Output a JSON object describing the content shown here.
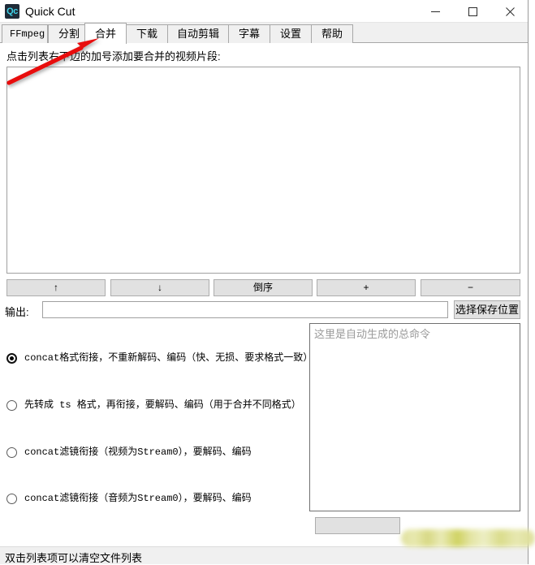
{
  "window": {
    "app_icon_text": "Qc",
    "title": "Quick Cut",
    "controls": {
      "minimize": "minimize-icon",
      "maximize": "maximize-icon",
      "close": "close-icon"
    }
  },
  "tabs": [
    {
      "label": "FFmpeg",
      "active": false,
      "mono": true
    },
    {
      "label": "分割",
      "active": false,
      "mono": false
    },
    {
      "label": "合并",
      "active": true,
      "mono": false
    },
    {
      "label": "下载",
      "active": false,
      "mono": false
    },
    {
      "label": "自动剪辑",
      "active": false,
      "mono": false
    },
    {
      "label": "字幕",
      "active": false,
      "mono": false
    },
    {
      "label": "设置",
      "active": false,
      "mono": false
    },
    {
      "label": "帮助",
      "active": false,
      "mono": false
    }
  ],
  "main": {
    "hint_label": "点击列表右下边的加号添加要合并的视频片段:",
    "file_list_items": [],
    "list_buttons": [
      {
        "label": "↑",
        "name": "move-up-button"
      },
      {
        "label": "↓",
        "name": "move-down-button"
      },
      {
        "label": "倒序",
        "name": "reverse-order-button"
      },
      {
        "label": "+",
        "name": "add-file-button"
      },
      {
        "label": "−",
        "name": "remove-file-button"
      }
    ],
    "output": {
      "label": "输出:",
      "value": "",
      "placeholder": "",
      "browse_button": "选择保存位置"
    },
    "merge_modes": [
      {
        "label": "concat格式衔接，不重新解码、编码（快、无损、要求格式一致）",
        "checked": true
      },
      {
        "label": "先转成 ts 格式，再衔接，要解码、编码（用于合并不同格式）",
        "checked": false
      },
      {
        "label": "concat滤镜衔接（视频为Stream0），要解码、编码",
        "checked": false
      },
      {
        "label": "concat滤镜衔接（音频为Stream0），要解码、编码",
        "checked": false
      }
    ],
    "command_box": {
      "value": "",
      "placeholder": "这里是自动生成的总命令"
    },
    "run_button": ""
  },
  "statusbar": {
    "text": "双击列表项可以清空文件列表"
  },
  "annotation": {
    "arrow_color": "#e8100f",
    "arrow_name": "red-pointer-arrow"
  }
}
